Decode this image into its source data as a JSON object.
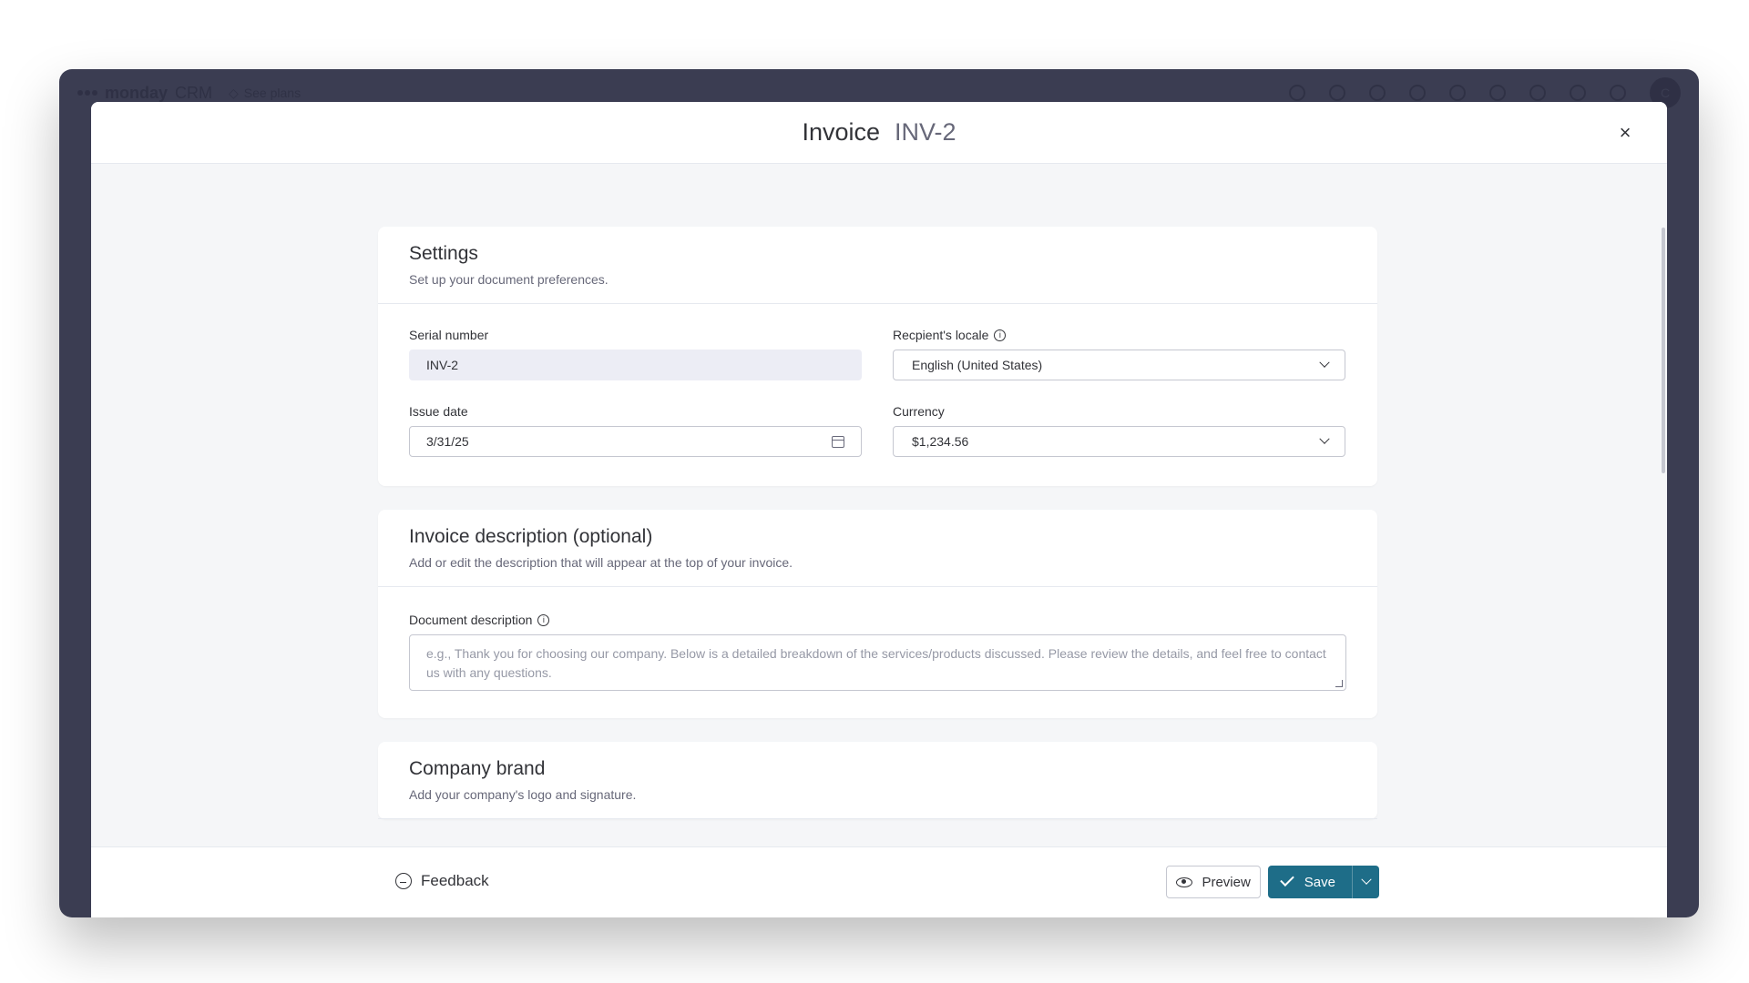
{
  "app": {
    "logo_text": "monday",
    "logo_suffix": "CRM",
    "see_plans": "See plans",
    "avatar_initial": "C"
  },
  "modal": {
    "title": "Invoice",
    "invoice_number": "INV-2",
    "close_symbol": "×"
  },
  "settings": {
    "title": "Settings",
    "subtitle": "Set up your document preferences.",
    "serial_label": "Serial number",
    "serial_value": "INV-2",
    "locale_label": "Recpient's locale",
    "locale_value": "English (United States)",
    "issue_date_label": "Issue date",
    "issue_date_value": "3/31/25",
    "currency_label": "Currency",
    "currency_value": "$1,234.56"
  },
  "description": {
    "title": "Invoice description (optional)",
    "subtitle": "Add or edit the description that will appear at the top of your invoice.",
    "doc_label": "Document description",
    "placeholder": "e.g., Thank you for choosing our company. Below is a detailed breakdown of the services/products discussed. Please review the details, and feel free to contact us with any questions."
  },
  "brand": {
    "title": "Company brand",
    "subtitle": "Add your company's logo and signature."
  },
  "footer": {
    "feedback": "Feedback",
    "preview": "Preview",
    "save": "Save"
  },
  "colors": {
    "accent": "#1e6d88",
    "background": "#f5f6f8",
    "app_frame": "#3b3d52"
  },
  "icons": [
    "diamond-icon",
    "bell-icon",
    "inbox-icon",
    "person-add-icon",
    "puzzle-icon",
    "apps-icon",
    "gear-icon",
    "search-icon",
    "help-icon",
    "grid-icon",
    "close-icon",
    "info-icon",
    "chevron-down-icon",
    "calendar-icon",
    "feedback-icon",
    "eye-icon",
    "check-icon"
  ]
}
